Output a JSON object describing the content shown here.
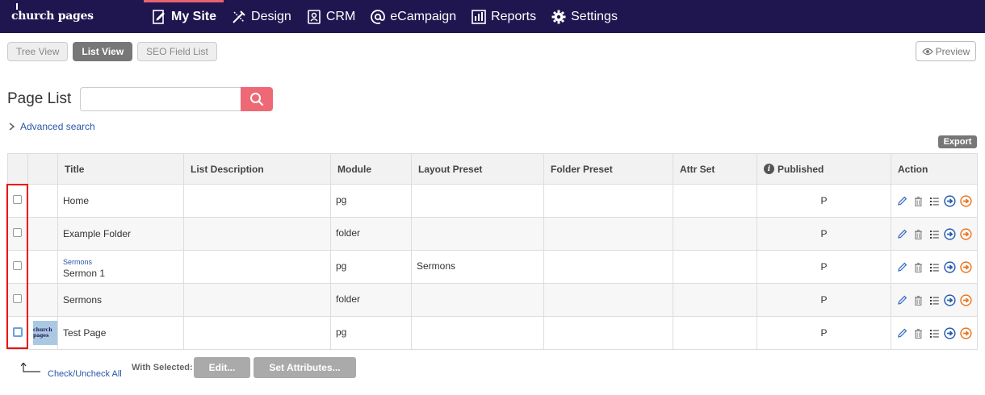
{
  "brand": {
    "logo_text": "church pages"
  },
  "nav": {
    "items": [
      {
        "label": "My Site",
        "icon": "edit-page-icon"
      },
      {
        "label": "Design",
        "icon": "tools-icon"
      },
      {
        "label": "CRM",
        "icon": "contacts-icon"
      },
      {
        "label": "eCampaign",
        "icon": "at-icon"
      },
      {
        "label": "Reports",
        "icon": "bar-chart-icon"
      },
      {
        "label": "Settings",
        "icon": "gear-icon"
      }
    ],
    "active": "My Site"
  },
  "subtabs": [
    {
      "label": "Tree View",
      "active": false
    },
    {
      "label": "List View",
      "active": true
    },
    {
      "label": "SEO Field List",
      "active": false
    }
  ],
  "preview_label": "Preview",
  "page_list": {
    "title": "Page List",
    "search_placeholder": "",
    "advanced_search_label": "Advanced search",
    "export_label": "Export"
  },
  "table": {
    "columns": [
      "",
      "",
      "Title",
      "List Description",
      "Module",
      "Layout Preset",
      "Folder Preset",
      "Attr Set",
      "Published",
      "Action"
    ],
    "rows": [
      {
        "folder": "",
        "title": "Home",
        "description": "",
        "module": "pg",
        "layout_preset": "",
        "folder_preset": "",
        "attr_set": "",
        "published": "P",
        "thumb": false
      },
      {
        "folder": "",
        "title": "Example Folder",
        "description": "",
        "module": "folder",
        "layout_preset": "",
        "folder_preset": "",
        "attr_set": "",
        "published": "P",
        "thumb": false
      },
      {
        "folder": "Sermons",
        "title": "Sermon 1",
        "description": "",
        "module": "pg",
        "layout_preset": "Sermons",
        "folder_preset": "",
        "attr_set": "",
        "published": "P",
        "thumb": false
      },
      {
        "folder": "",
        "title": "Sermons",
        "description": "",
        "module": "folder",
        "layout_preset": "",
        "folder_preset": "",
        "attr_set": "",
        "published": "P",
        "thumb": false
      },
      {
        "folder": "",
        "title": "Test Page",
        "description": "",
        "module": "pg",
        "layout_preset": "",
        "folder_preset": "",
        "attr_set": "",
        "published": "P",
        "thumb": true,
        "thumb_text": "church pages"
      }
    ]
  },
  "footer": {
    "check_all_label": "Check/Uncheck All",
    "with_selected_label": "With Selected:",
    "edit_label": "Edit...",
    "set_attributes_label": "Set Attributes..."
  },
  "colors": {
    "nav_bg": "#1f1650",
    "accent": "#ee6975",
    "link": "#2a55a8",
    "highlight": "#ee0000"
  }
}
